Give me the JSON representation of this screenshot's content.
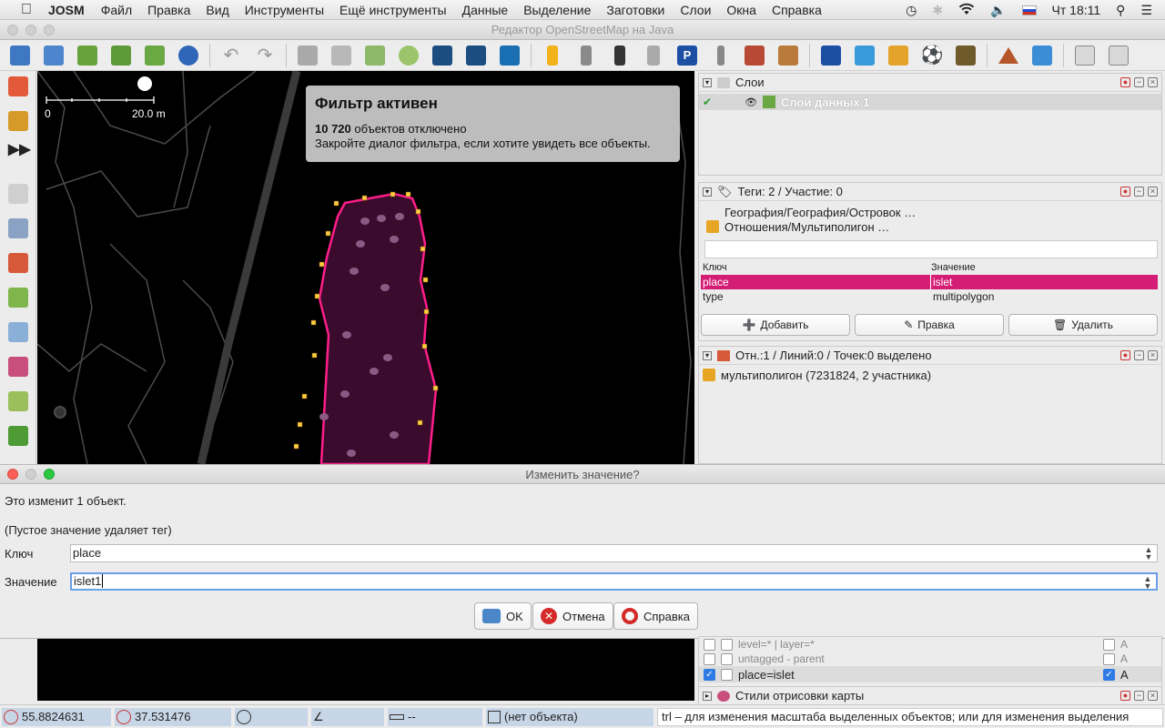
{
  "menubar": {
    "app": "JOSM",
    "items": [
      "Файл",
      "Правка",
      "Вид",
      "Инструменты",
      "Ещё инструменты",
      "Данные",
      "Выделение",
      "Заготовки",
      "Слои",
      "Окна",
      "Справка"
    ],
    "clock": "Чт 18:11"
  },
  "window": {
    "title": "Редактор OpenStreetMap на Java"
  },
  "map": {
    "scale_start": "0",
    "scale_end": "20.0 m",
    "filter_title": "Фильтр активен",
    "filter_count": "10 720",
    "filter_count_suffix": " объектов отключено",
    "filter_hint": "Закройте диалог фильтра, если хотите увидеть все объекты."
  },
  "layers_panel": {
    "title": "Слои",
    "layer_name": "Слой данных 1"
  },
  "tags_panel": {
    "title": "Теги: 2 / Участие: 0",
    "preset1": "География/География/Островок …",
    "preset2": "Отношения/Мультиполигон …",
    "col_key": "Ключ",
    "col_value": "Значение",
    "rows": [
      {
        "key": "place",
        "value": "islet"
      },
      {
        "key": "type",
        "value": "multipolygon"
      }
    ],
    "add": "Добавить",
    "edit": "Правка",
    "delete": "Удалить"
  },
  "selection_panel": {
    "title": "Отн.:1 / Линий:0 / Точек:0 выделено",
    "item": "мультиполигон (7231824, 2 участника)"
  },
  "filter_list": {
    "rows": [
      {
        "text": "level=* | layer=*",
        "mode": "A"
      },
      {
        "text": "untagged - parent",
        "mode": "A"
      },
      {
        "text": "place=islet",
        "mode": "A"
      }
    ],
    "styles_title": "Стили отрисовки карты"
  },
  "dialog": {
    "title": "Изменить значение?",
    "message": "Это изменит 1 объект.",
    "note": "(Пустое значение удаляет тег)",
    "key_label": "Ключ",
    "key_value": "place",
    "value_label": "Значение",
    "value_value": "islet1",
    "ok": "OK",
    "cancel": "Отмена",
    "help": "Справка"
  },
  "statusbar": {
    "lat": "55.8824631",
    "lon": "37.531476",
    "dist": "--",
    "object": "(нет объекта)",
    "hint": "trl – для изменения масштаба выделенных объектов; или для изменения выделения"
  }
}
